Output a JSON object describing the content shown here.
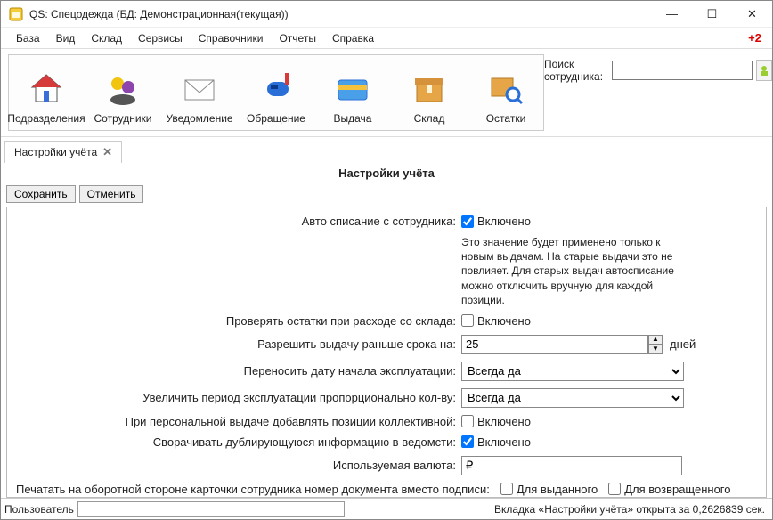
{
  "window": {
    "title": "QS: Спецодежда (БД: Демонстрационная(текущая))",
    "minimize": "—",
    "maximize": "☐",
    "close": "✕"
  },
  "menu": {
    "items": [
      "База",
      "Вид",
      "Склад",
      "Сервисы",
      "Справочники",
      "Отчеты",
      "Справка"
    ],
    "plus": "+2"
  },
  "toolbar": {
    "items": [
      {
        "label": "Подразделения"
      },
      {
        "label": "Сотрудники"
      },
      {
        "label": "Уведомление"
      },
      {
        "label": "Обращение"
      },
      {
        "label": "Выдача"
      },
      {
        "label": "Склад"
      },
      {
        "label": "Остатки"
      }
    ]
  },
  "search": {
    "label": "Поиск сотрудника:",
    "value": ""
  },
  "tab": {
    "label": "Настройки учёта"
  },
  "page": {
    "title": "Настройки учёта",
    "save": "Сохранить",
    "cancel": "Отменить"
  },
  "form": {
    "auto_writeoff": {
      "label": "Авто списание с сотрудника:",
      "cb_label": "Включено",
      "checked": true
    },
    "auto_note": "Это значение будет применено только к новым выдачам. На старые выдачи это не повлияет. Для старых выдач автосписание можно отключить вручную для каждой позиции.",
    "check_stock": {
      "label": "Проверять остатки при расходе со склада:",
      "cb_label": "Включено",
      "checked": false
    },
    "allow_early": {
      "label": "Разрешить выдачу раньше срока на:",
      "value": "25",
      "unit": "дней"
    },
    "shift_date": {
      "label": "Переносить дату начала эксплуатации:",
      "value": "Всегда да"
    },
    "extend_period": {
      "label": "Увеличить период эксплуатации пропорционально кол-ву:",
      "value": "Всегда да"
    },
    "add_collective": {
      "label": "При персональной выдаче добавлять позиции коллективной:",
      "cb_label": "Включено",
      "checked": false
    },
    "collapse_dup": {
      "label": "Сворачивать дублирующуюся информацию в ведомсти:",
      "cb_label": "Включено",
      "checked": true
    },
    "currency": {
      "label": "Используемая валюта:",
      "value": "₽"
    },
    "print_back": {
      "label": "Печатать на оборотной стороне карточки сотрудника номер документа вместо подписи:",
      "issued": {
        "label": "Для выданного",
        "checked": false
      },
      "returned": {
        "label": "Для возвращенного",
        "checked": false
      }
    }
  },
  "status": {
    "user_label": "Пользователь",
    "user_value": "",
    "right": "Вкладка «Настройки учёта» открыта за 0,2626839 сек."
  }
}
